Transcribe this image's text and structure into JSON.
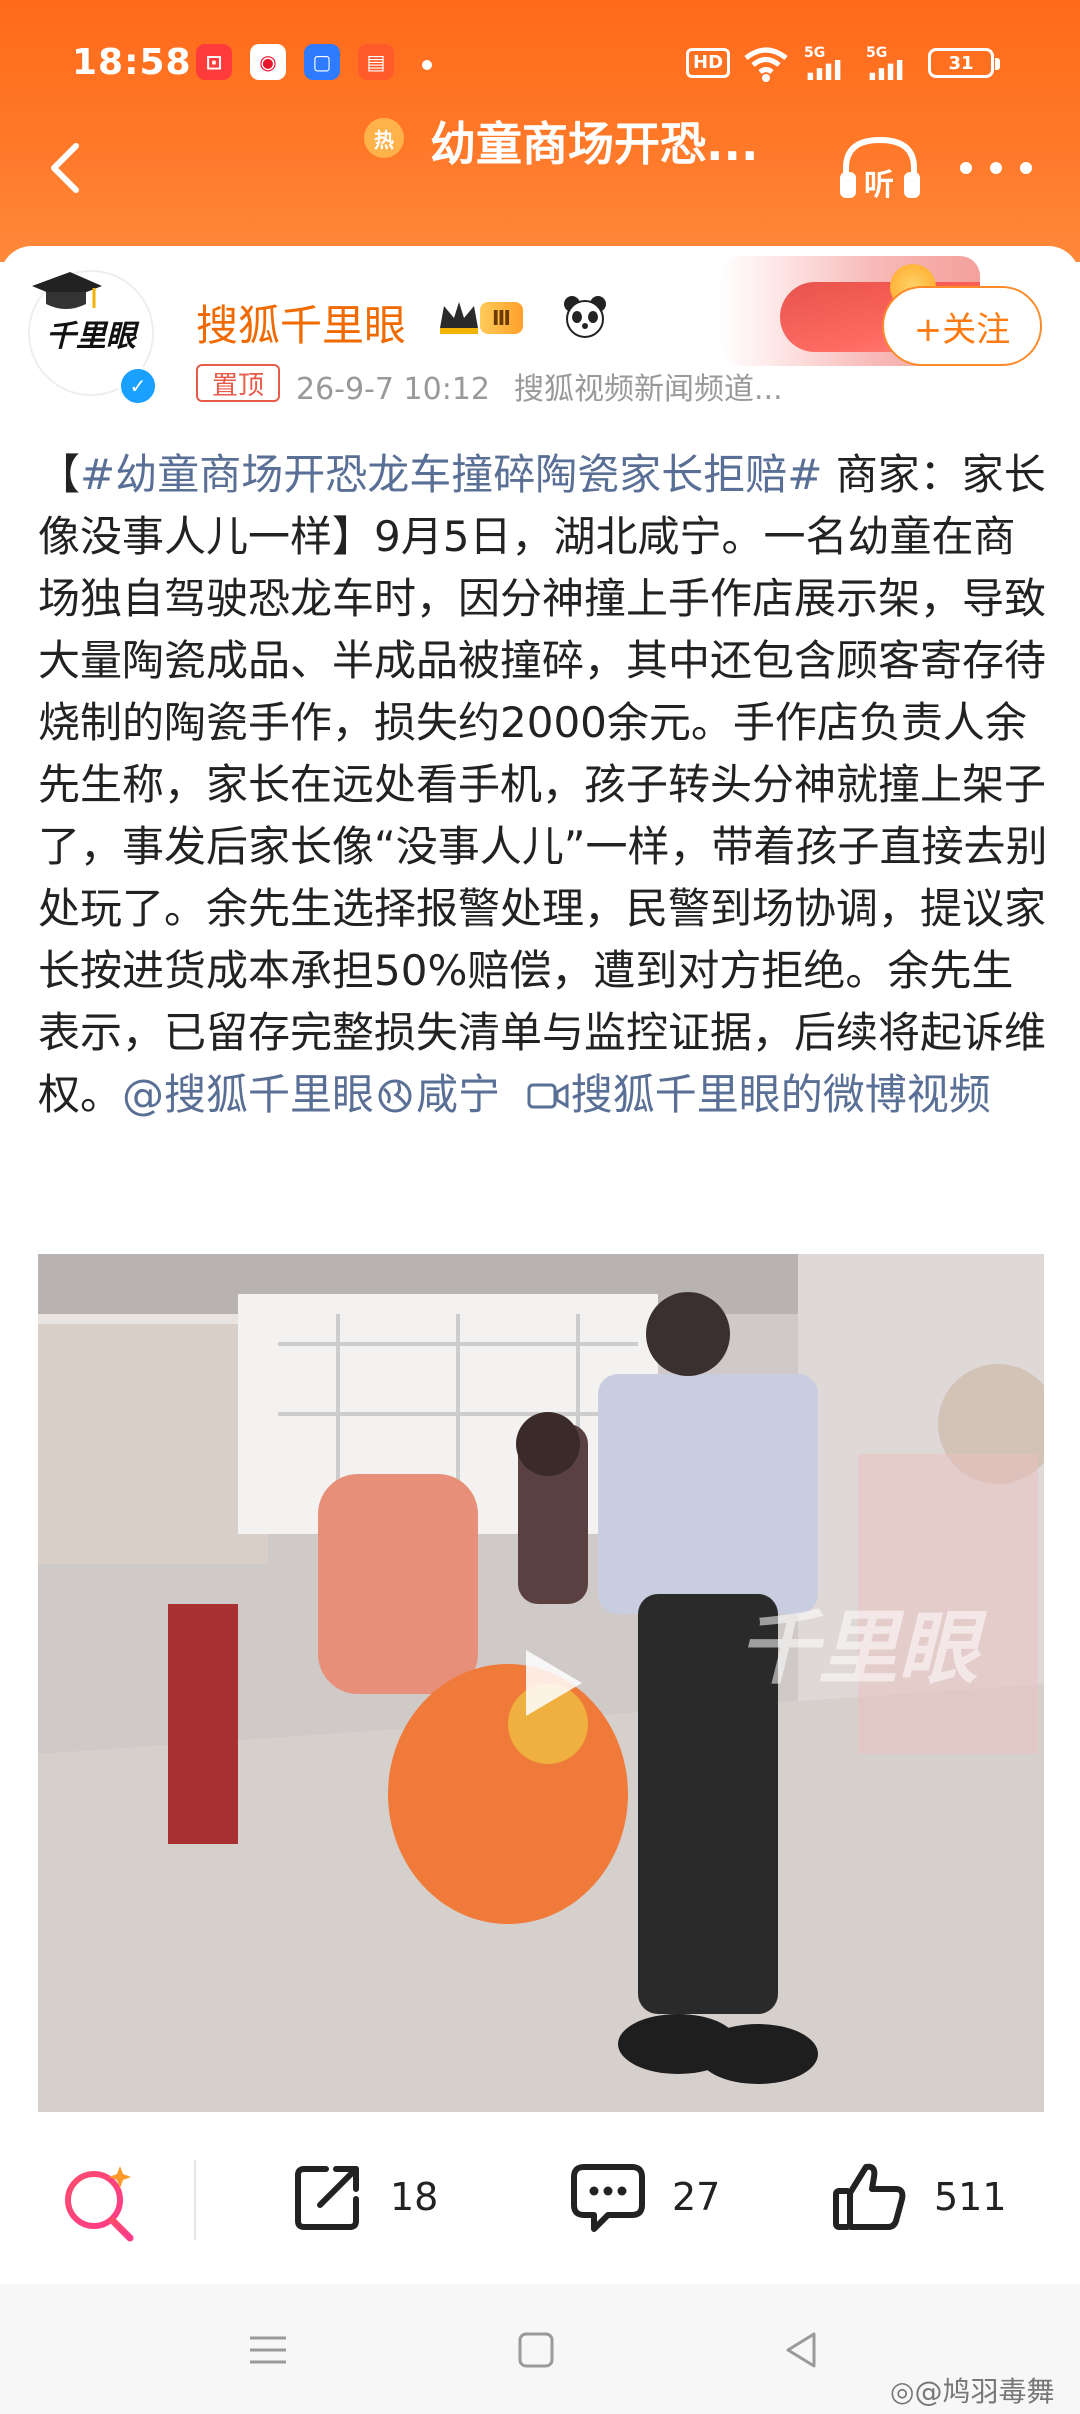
{
  "status_bar": {
    "time": "18:58",
    "hd_label": "HD",
    "signal1": "5G",
    "signal2": "5G",
    "battery": "31"
  },
  "nav": {
    "title": "幼童商场开恐...",
    "hot_badge": "热",
    "listen_label": "听"
  },
  "post": {
    "author": "搜狐千里眼",
    "level": "Ⅲ",
    "follow_label": "+关注",
    "pinned_label": "置顶",
    "timestamp": "26-9-7 10:12",
    "source": "搜狐视频新闻频道...",
    "avatar_text": "千里眼",
    "text": {
      "bracket_open": "【",
      "topic": "#幼童商场开恐龙车撞碎陶瓷家长拒赔#",
      "body": " 商家：家长像没事人儿一样】9月5日，湖北咸宁。一名幼童在商场独自驾驶恐龙车时，因分神撞上手作店展示架，导致大量陶瓷成品、半成品被撞碎，其中还包含顾客寄存待烧制的陶瓷手作，损失约2000余元。手作店负责人余先生称，家长在远处看手机，孩子转头分神就撞上架子了，事发后家长像“没事人儿”一样，带着孩子直接去别处玩了。余先生选择报警处理，民警到场协调，提议家长按进货成本承担50%赔偿，遭到对方拒绝。余先生表示，已留存完整损失清单与监控证据，后续将起诉维权。",
      "mention": "@搜狐千里眼",
      "location": "咸宁",
      "video_link": "搜狐千里眼的微博视频"
    },
    "video_watermark": "千里眼"
  },
  "actions": {
    "share_count": "18",
    "comment_count": "27",
    "like_count": "511"
  },
  "credit": "@鸠羽毒舞",
  "colors": {
    "header_orange": "#ff6a1a",
    "author_orange": "#f06a00",
    "link_blue": "#5a6f96"
  }
}
